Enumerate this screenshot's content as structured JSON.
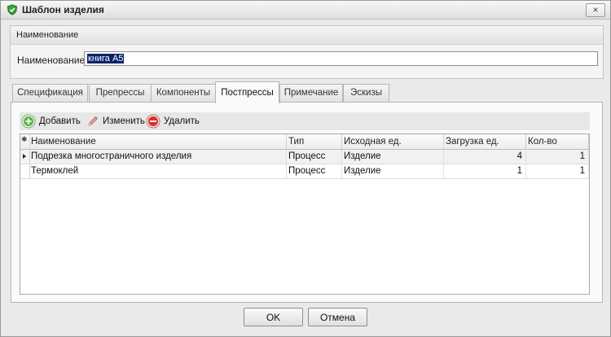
{
  "window": {
    "title": "Шаблон изделия",
    "close_glyph": "×"
  },
  "naming": {
    "group_title": "Наименование",
    "label": "Наименование:",
    "value": "книга А5"
  },
  "tabs": [
    {
      "label": "Спецификация",
      "active": false
    },
    {
      "label": "Препрессы",
      "active": false
    },
    {
      "label": "Компоненты",
      "active": false
    },
    {
      "label": "Постпрессы",
      "active": true
    },
    {
      "label": "Примечание",
      "active": false
    },
    {
      "label": "Эскизы",
      "active": false
    }
  ],
  "toolbar": {
    "add_label": "Добавить",
    "edit_label": "Изменить",
    "delete_label": "Удалить"
  },
  "grid": {
    "indicator_header": "✱",
    "columns": [
      "Наименование",
      "Тип",
      "Исходная ед.",
      "Загрузка ед.",
      "Кол-во"
    ],
    "rows": [
      [
        "Подрезка многостраничного изделия",
        "Процесс",
        "Изделие",
        "4",
        "1"
      ],
      [
        "Термоклей",
        "Процесс",
        "Изделие",
        "1",
        "1"
      ]
    ]
  },
  "footer": {
    "ok_label": "OK",
    "cancel_label": "Отмена"
  },
  "icons": {
    "title": "green-shield-icon",
    "add": "green-plus-icon",
    "edit": "pencil-icon",
    "delete": "red-minus-icon"
  },
  "colors": {
    "selection": "#0a246a",
    "add": "#3fa63a",
    "delete": "#d9302c"
  }
}
